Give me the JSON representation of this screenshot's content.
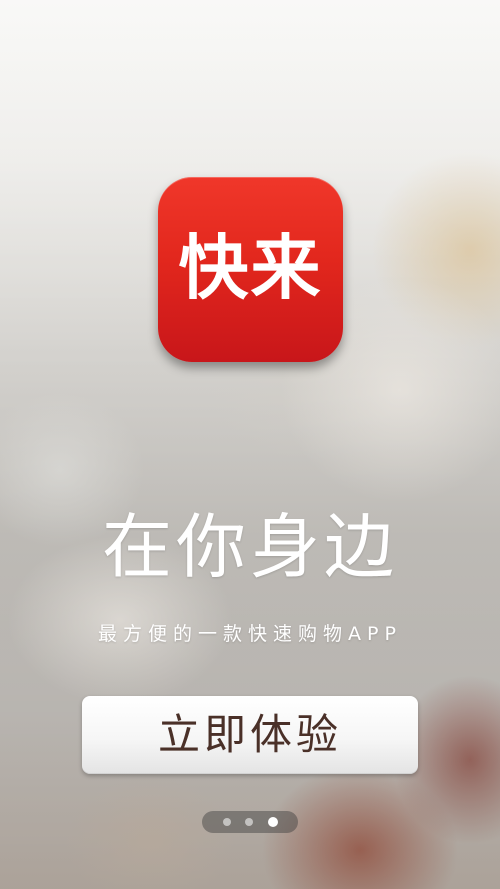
{
  "app": {
    "icon_text": "快来",
    "icon_colors": {
      "top": "#f0372a",
      "bottom": "#c8161a"
    }
  },
  "headline": "在你身边",
  "tagline": "最方便的一款快速购物APP",
  "cta": {
    "label": "立即体验",
    "label_color": "#4a3028"
  },
  "pager": {
    "total_pages": 3,
    "current_page": 3
  }
}
